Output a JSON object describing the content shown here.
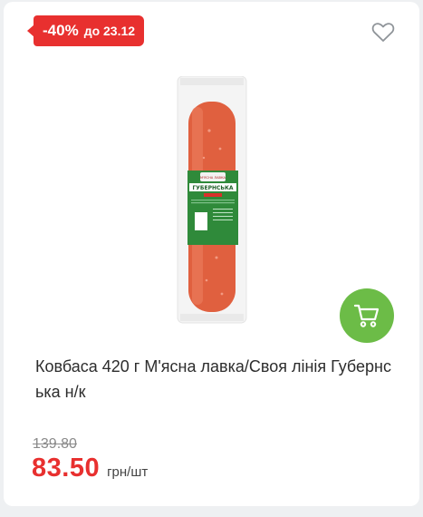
{
  "badge": {
    "discount": "-40%",
    "until": "до 23.12"
  },
  "product": {
    "title": "Ковбаса 420 г М'ясна лавка/Своя лінія Губернська н/к",
    "label_brand": "М'ЯСНА ЛАВКА",
    "label_name": "ГУБЕРНСЬКА",
    "old_price": "139.80",
    "price": "83.50",
    "unit": "грн/шт"
  },
  "colors": {
    "badge": "#e8302f",
    "price": "#e8302f",
    "cart_button": "#6cbc47",
    "sausage": "#e0603f",
    "label_green": "#2f8a3a"
  },
  "icons": {
    "favorite": "heart-icon",
    "cart": "cart-icon"
  }
}
